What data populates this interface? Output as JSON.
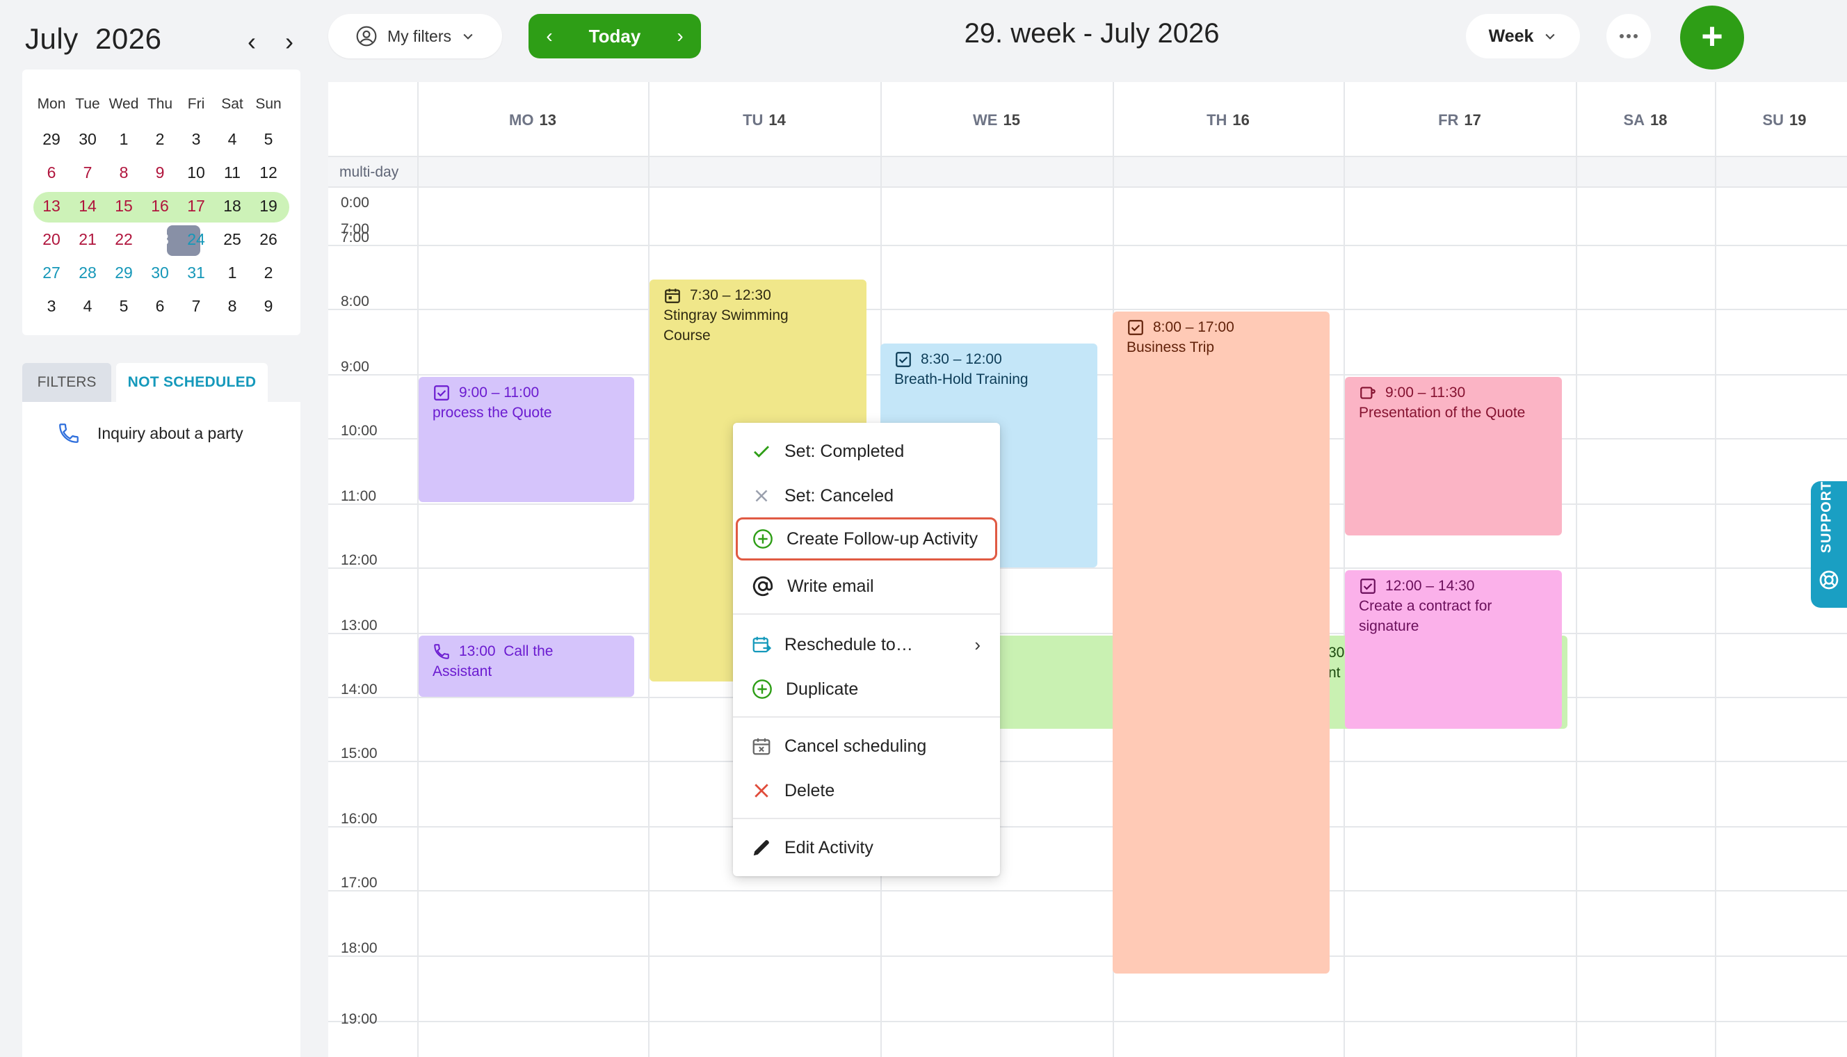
{
  "mini_calendar": {
    "title_month": "July",
    "title_year": "2026",
    "prev": "‹",
    "next": "›",
    "weekdays": [
      "Mon",
      "Tue",
      "Wed",
      "Thu",
      "Fri",
      "Sat",
      "Sun"
    ],
    "weeks": [
      [
        "29",
        "30",
        "1",
        "2",
        "3",
        "4",
        "5"
      ],
      [
        "6",
        "7",
        "8",
        "9",
        "10",
        "11",
        "12"
      ],
      [
        "13",
        "14",
        "15",
        "16",
        "17",
        "18",
        "19"
      ],
      [
        "20",
        "21",
        "22",
        "23",
        "24",
        "25",
        "26"
      ],
      [
        "27",
        "28",
        "29",
        "30",
        "31",
        "1",
        "2"
      ],
      [
        "3",
        "4",
        "5",
        "6",
        "7",
        "8",
        "9"
      ]
    ],
    "today": "23"
  },
  "side_tabs": {
    "filters": "FILTERS",
    "not_scheduled": "NOT SCHEDULED"
  },
  "not_scheduled_items": [
    "Inquiry about a party"
  ],
  "toolbar": {
    "my_filters": "My filters",
    "today": "Today",
    "week_title": "29. week - July 2026",
    "view": "Week",
    "add": "+"
  },
  "days": [
    {
      "abbr": "MO",
      "num": "13"
    },
    {
      "abbr": "TU",
      "num": "14"
    },
    {
      "abbr": "WE",
      "num": "15"
    },
    {
      "abbr": "TH",
      "num": "16"
    },
    {
      "abbr": "FR",
      "num": "17"
    },
    {
      "abbr": "SA",
      "num": "18"
    },
    {
      "abbr": "SU",
      "num": "19"
    }
  ],
  "grid_labels": {
    "multi_day": "multi-day",
    "early_start": "0:00",
    "early_end": "7:00",
    "hours": [
      "7:00",
      "8:00",
      "9:00",
      "10:00",
      "11:00",
      "12:00",
      "13:00",
      "14:00",
      "15:00",
      "16:00",
      "17:00",
      "18:00",
      "19:00"
    ]
  },
  "events": {
    "quote": {
      "time": "9:00 – 11:00",
      "title": "process the Quote"
    },
    "assistant": {
      "time": "13:00",
      "title_a": "Call the",
      "title_b": "Assistant"
    },
    "stingray": {
      "time": "7:30 – 12:30",
      "title": "Stingray Swimming Course"
    },
    "breath": {
      "time": "8:30 – 12:00",
      "title": "Breath-Hold Training"
    },
    "green": {
      "time": "30",
      "title": "nt"
    },
    "trip": {
      "time": "8:00 – 17:00",
      "title": "Business Trip"
    },
    "presentation": {
      "time": "9:00 – 11:30",
      "title": "Presentation of the Quote"
    },
    "contract": {
      "time": "12:00 – 14:30",
      "title": "Create a contract for signature"
    }
  },
  "context_menu": {
    "completed": "Set: Completed",
    "canceled": "Set: Canceled",
    "follow_up": "Create Follow-up Activity",
    "email": "Write email",
    "reschedule": "Reschedule to…",
    "duplicate": "Duplicate",
    "cancel_scheduling": "Cancel scheduling",
    "delete": "Delete",
    "edit": "Edit Activity"
  },
  "support": "SUPPORT",
  "colors": {
    "accent_green": "#2e9e16",
    "teal": "#1599bb",
    "weekend_red": "#b0143c",
    "highlight_border": "#e05a43"
  }
}
